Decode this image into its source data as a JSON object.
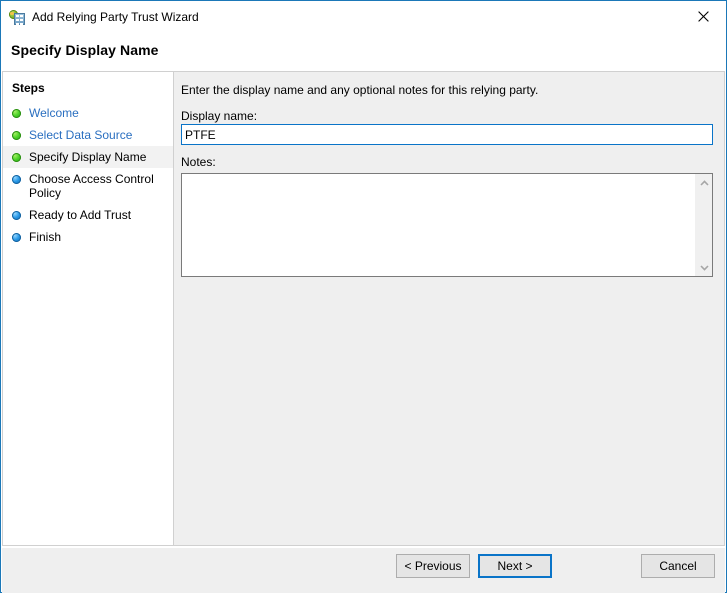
{
  "window": {
    "title": "Add Relying Party Trust Wizard",
    "icon": "relying-party-trust-icon",
    "close_label": "✕",
    "border_color": "#1b78b8"
  },
  "header": {
    "title": "Specify Display Name"
  },
  "steps_pane": {
    "heading": "Steps",
    "items": [
      {
        "label": "Welcome",
        "state": "completed",
        "bullet": "green"
      },
      {
        "label": "Select Data Source",
        "state": "completed",
        "bullet": "green"
      },
      {
        "label": "Specify Display Name",
        "state": "current",
        "bullet": "green"
      },
      {
        "label": "Choose Access Control Policy",
        "state": "upcoming",
        "bullet": "blue"
      },
      {
        "label": "Ready to Add Trust",
        "state": "upcoming",
        "bullet": "blue"
      },
      {
        "label": "Finish",
        "state": "upcoming",
        "bullet": "blue"
      }
    ]
  },
  "content": {
    "intro": "Enter the display name and any optional notes for this relying party.",
    "display_name_label": "Display name:",
    "display_name_value": "PTFE",
    "display_name_placeholder": "",
    "notes_label": "Notes:",
    "notes_value": "",
    "notes_placeholder": ""
  },
  "scrollbar": {
    "up_icon": "chevron-up-icon",
    "down_icon": "chevron-down-icon"
  },
  "footer": {
    "previous_label": "< Previous",
    "next_label": "Next >",
    "cancel_label": "Cancel"
  },
  "colors": {
    "accent": "#0a74c8",
    "pane_background": "#efefef",
    "completed_link": "#2a6fc0",
    "bullet_green": "#4ed42a",
    "bullet_blue": "#2a9ae8"
  }
}
